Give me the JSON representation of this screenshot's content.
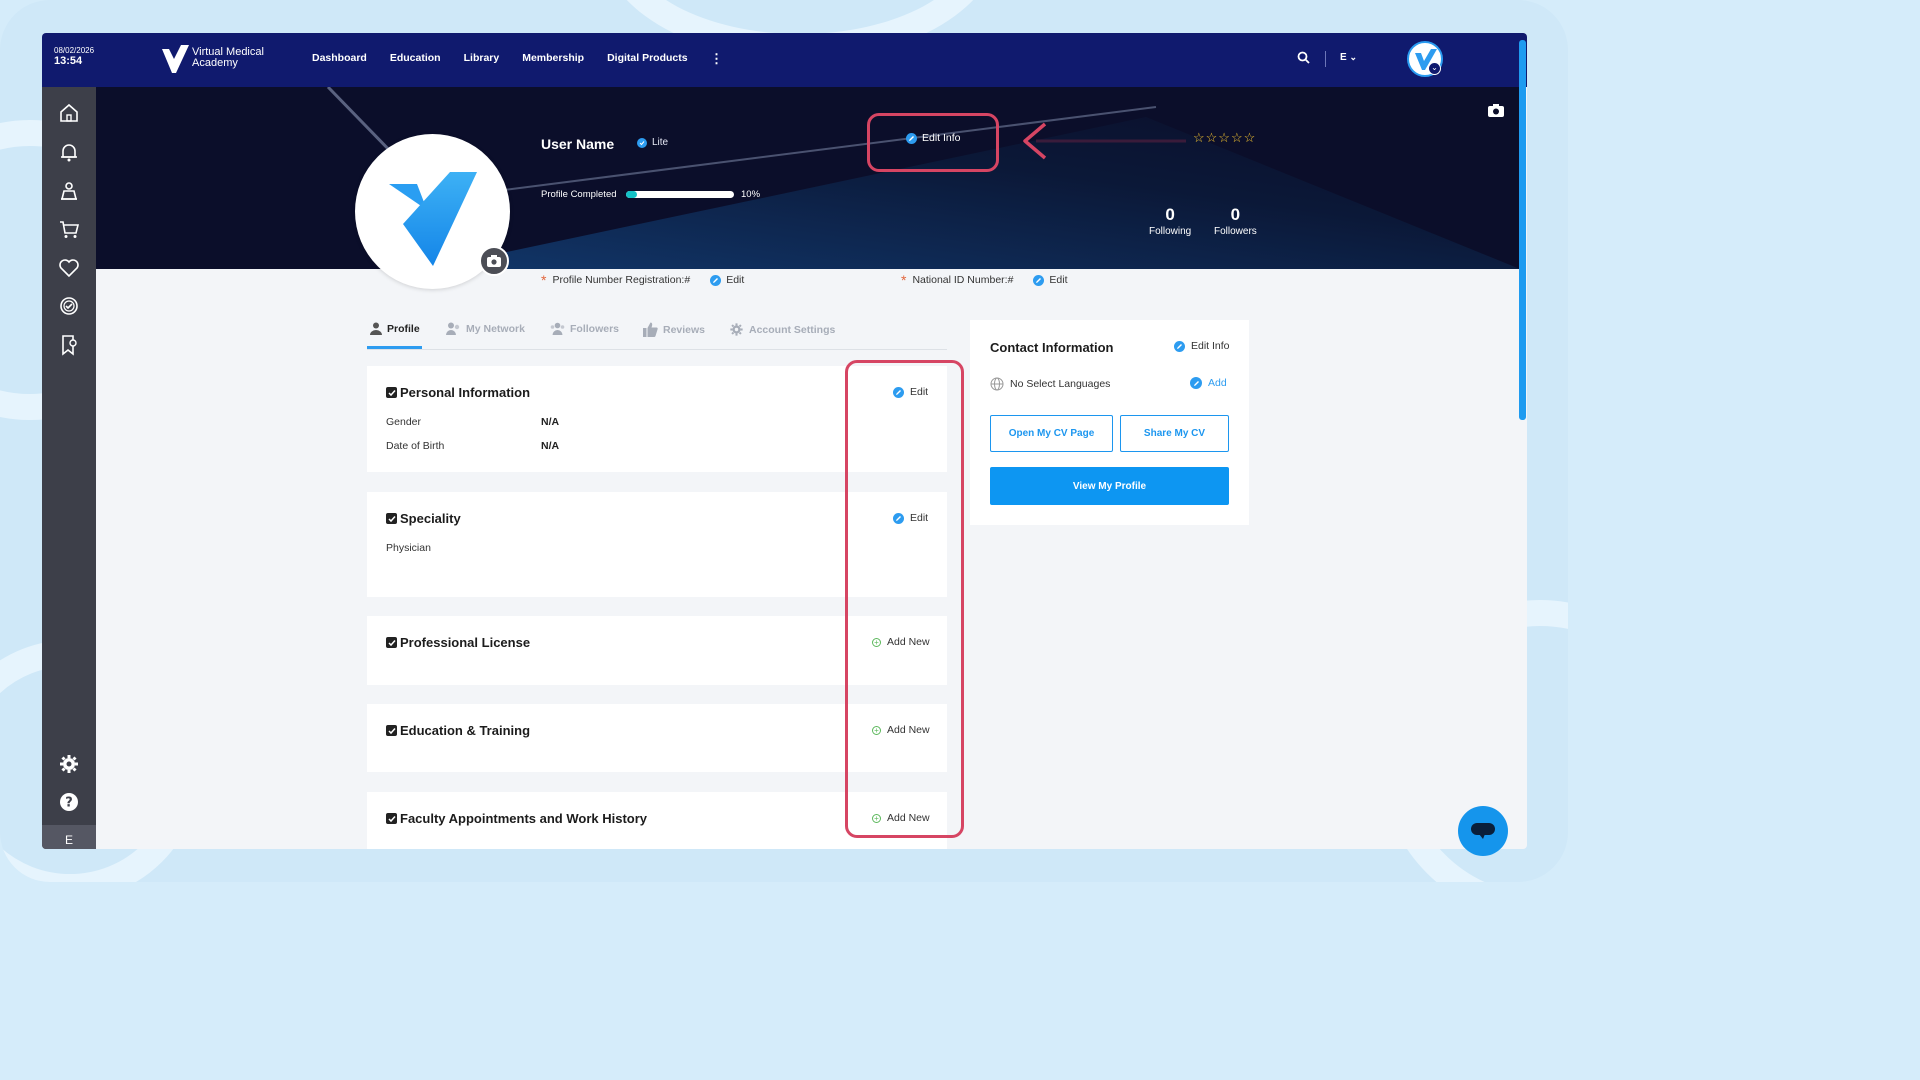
{
  "colors": {
    "nav": "#101a6e",
    "accent": "#0d96f2",
    "annotation": "#d64563",
    "sidebar": "#3d3f49",
    "hero": "#0b0e2a"
  },
  "topbar": {
    "date": "08/02/2026",
    "time": "13:54",
    "logo_text": "Virtual Medical Academy",
    "nav_items": [
      "Dashboard",
      "Education",
      "Library",
      "Membership",
      "Digital Products"
    ],
    "more_icon": "kebab-menu-icon",
    "search_icon": "search-icon",
    "language": "E",
    "avatar_badge_icon": "chevron-down-icon"
  },
  "sidebar": {
    "icons": [
      "home-icon",
      "bell-icon",
      "graduation-icon",
      "cart-icon",
      "heart-icon",
      "badge-check-icon",
      "bookmark-settings-icon"
    ],
    "bottom_icons": [
      "gear-icon",
      "help-icon"
    ],
    "footer_label": "E"
  },
  "profile": {
    "user_name": "User Name",
    "plan": "Lite",
    "profile_completed_label": "Profile Completed",
    "profile_completed_pct": 10,
    "profile_completed_text": "10%",
    "edit_info_label": "Edit Info",
    "rating_stars": "☆☆☆☆☆",
    "following_count": "0",
    "following_label": "Following",
    "followers_count": "0",
    "followers_label": "Followers"
  },
  "registration": {
    "profile_number_label": "Profile Number Registration:#",
    "national_id_label": "National ID Number:#",
    "edit_label": "Edit"
  },
  "tabs": [
    {
      "label": "Profile",
      "icon": "user-icon",
      "active": true
    },
    {
      "label": "My Network",
      "icon": "network-icon",
      "active": false
    },
    {
      "label": "Followers",
      "icon": "followers-icon",
      "active": false
    },
    {
      "label": "Reviews",
      "icon": "thumbs-up-icon",
      "active": false
    },
    {
      "label": "Account Settings",
      "icon": "gear-icon",
      "active": false
    }
  ],
  "sections": {
    "personal": {
      "title": "Personal Information",
      "action": "Edit",
      "fields": [
        {
          "label": "Gender",
          "value": "N/A"
        },
        {
          "label": "Date of Birth",
          "value": "N/A"
        }
      ]
    },
    "speciality": {
      "title": "Speciality",
      "action": "Edit",
      "value": "Physician"
    },
    "license": {
      "title": "Professional License",
      "action": "Add New"
    },
    "education": {
      "title": "Education & Training",
      "action": "Add New"
    },
    "faculty": {
      "title": "Faculty Appointments and Work History",
      "action": "Add New"
    }
  },
  "contact": {
    "title": "Contact Information",
    "edit_label": "Edit Info",
    "languages_text": "No Select Languages",
    "add_label": "Add",
    "open_cv_label": "Open My CV Page",
    "share_cv_label": "Share My CV",
    "view_profile_label": "View My Profile"
  }
}
